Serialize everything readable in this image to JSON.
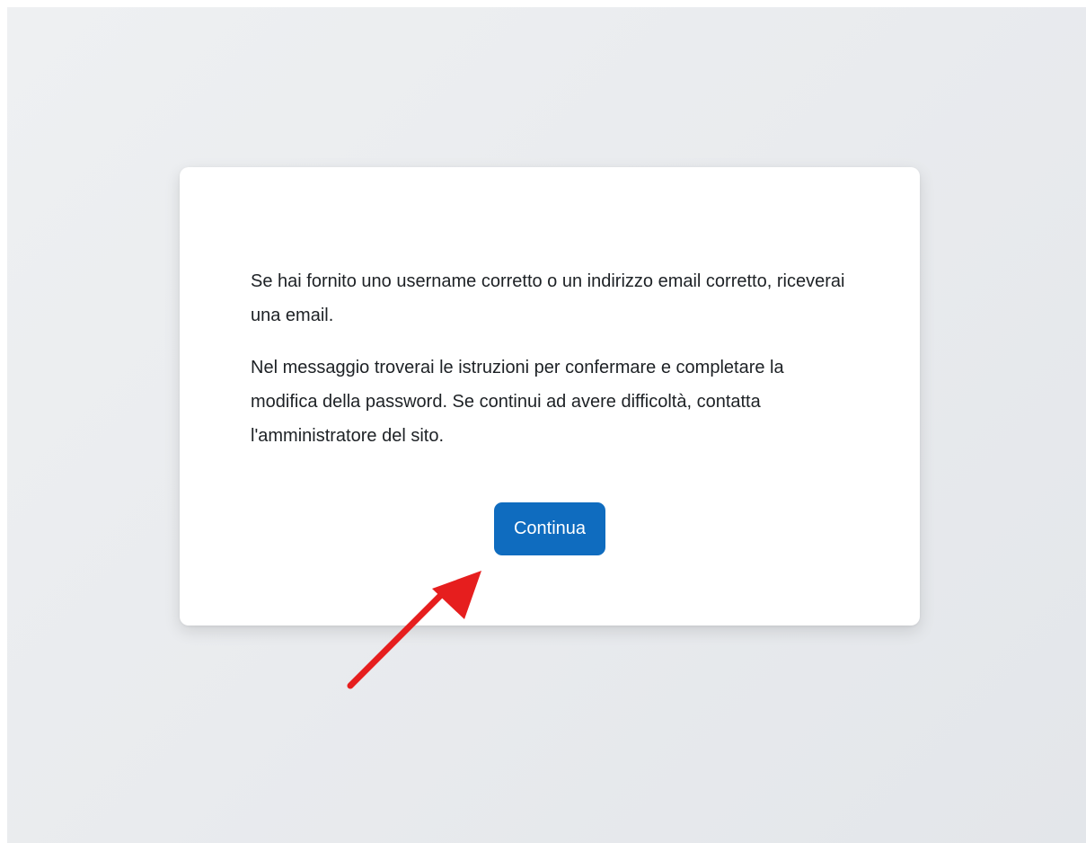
{
  "message": {
    "paragraph_1": "Se hai fornito uno username corretto o un indirizzo email corretto, riceverai una email.",
    "paragraph_2": "Nel messaggio troverai le istruzioni per confermare e completare la modifica della password. Se continui ad avere difficoltà, contatta l'amministratore del sito."
  },
  "actions": {
    "continue_label": "Continua"
  },
  "annotation": {
    "arrow_icon": "red-arrow-icon",
    "color": "#e61e1e"
  },
  "colors": {
    "button": "#0f6cbf",
    "text": "#1d2125",
    "card": "#ffffff"
  }
}
